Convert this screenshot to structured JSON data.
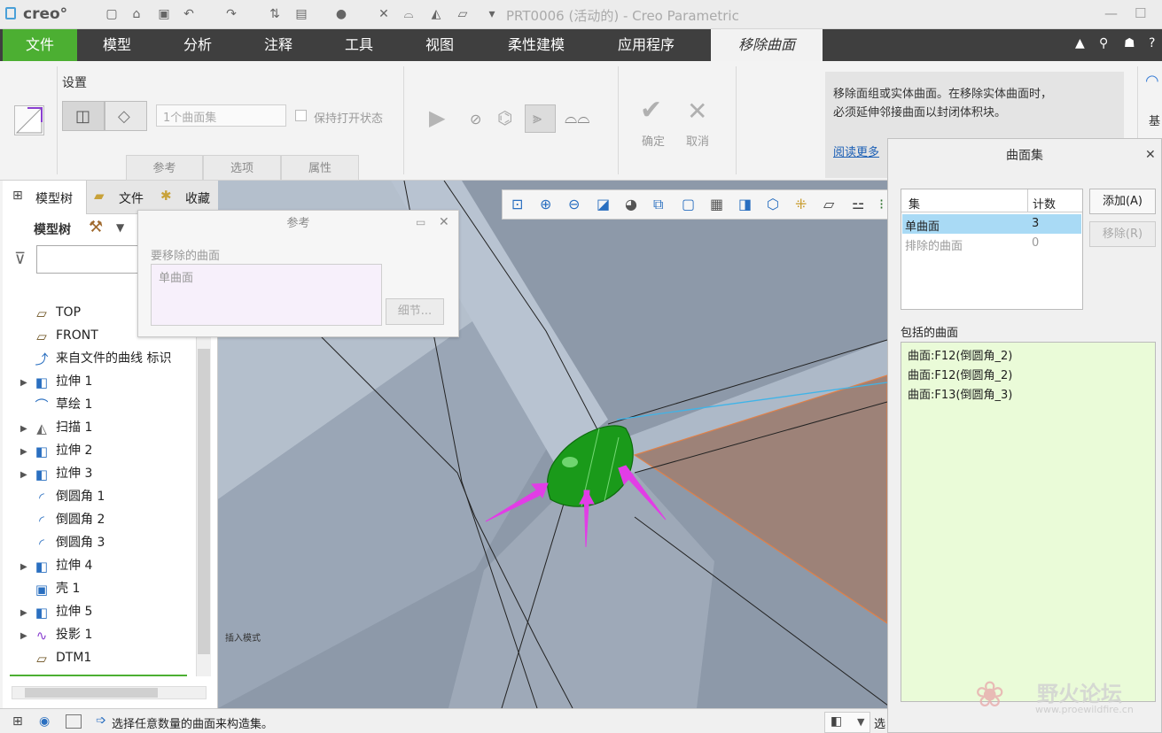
{
  "titlebar": {
    "logo": "creo°",
    "title": "PRT0006 (活动的) - Creo Parametric"
  },
  "tabs": [
    "文件",
    "模型",
    "分析",
    "注释",
    "工具",
    "视图",
    "柔性建模",
    "应用程序"
  ],
  "active_tab": "移除曲面",
  "ribbon": {
    "settings_label": "设置",
    "surface_collector": "1个曲面集",
    "keep_open_label": "保持打开状态",
    "ok_label": "确定",
    "cancel_label": "取消",
    "subtabs": [
      "参考",
      "选项",
      "属性"
    ],
    "help_text_1": "移除面组或实体曲面。在移除实体曲面时，",
    "help_text_2": "必须延伸邻接曲面以封闭体积块。",
    "read_more": "阅读更多",
    "cut_label": "基"
  },
  "left_panel": {
    "tabs": [
      "模型树",
      "文件",
      "收藏"
    ],
    "header": "模型树",
    "tree": [
      {
        "label": "TOP",
        "arrow": false,
        "icon": "plane"
      },
      {
        "label": "FRONT",
        "arrow": false,
        "icon": "plane"
      },
      {
        "label": "来自文件的曲线 标识",
        "arrow": false,
        "icon": "curve"
      },
      {
        "label": "拉伸 1",
        "arrow": true,
        "icon": "extrude"
      },
      {
        "label": "草绘 1",
        "arrow": false,
        "icon": "sketch"
      },
      {
        "label": "扫描 1",
        "arrow": true,
        "icon": "sweep"
      },
      {
        "label": "拉伸 2",
        "arrow": true,
        "icon": "extrude"
      },
      {
        "label": "拉伸 3",
        "arrow": true,
        "icon": "extrude"
      },
      {
        "label": "倒圆角 1",
        "arrow": false,
        "icon": "round"
      },
      {
        "label": "倒圆角 2",
        "arrow": false,
        "icon": "round"
      },
      {
        "label": "倒圆角 3",
        "arrow": false,
        "icon": "round"
      },
      {
        "label": "拉伸 4",
        "arrow": true,
        "icon": "extrude"
      },
      {
        "label": "壳 1",
        "arrow": false,
        "icon": "shell"
      },
      {
        "label": "拉伸 5",
        "arrow": true,
        "icon": "extrude"
      },
      {
        "label": "投影 1",
        "arrow": true,
        "icon": "project"
      },
      {
        "label": "DTM1",
        "arrow": false,
        "icon": "plane"
      }
    ]
  },
  "ref_popup": {
    "title": "参考",
    "field_label": "要移除的曲面",
    "field_value": "单曲面",
    "details_button": "细节..."
  },
  "viewport": {
    "insert_mode": "插入模式"
  },
  "surface_set_dialog": {
    "title": "曲面集",
    "table_headers": [
      "集",
      "计数"
    ],
    "rows": [
      {
        "name": "单曲面",
        "count": "3",
        "selected": true
      },
      {
        "name": "排除的曲面",
        "count": "0",
        "selected": false
      }
    ],
    "add_button": "添加(A)",
    "remove_button": "移除(R)",
    "included_label": "包括的曲面",
    "included": [
      "曲面:F12(倒圆角_2)",
      "曲面:F12(倒圆角_2)",
      "曲面:F13(倒圆角_3)"
    ]
  },
  "statusbar": {
    "message": "选择任意数量的曲面来构造集。",
    "right_text": "选"
  },
  "watermark": {
    "text": "野火论坛",
    "url": "www.proewildfire.cn"
  },
  "colors": {
    "file_tab": "#4caf32",
    "tab_bar": "#3f3f3f",
    "selection_blue": "#a9daf5",
    "included_bg": "#eafbd8",
    "highlight_green": "#1e9a1e",
    "arrow_magenta": "#e23de6"
  }
}
